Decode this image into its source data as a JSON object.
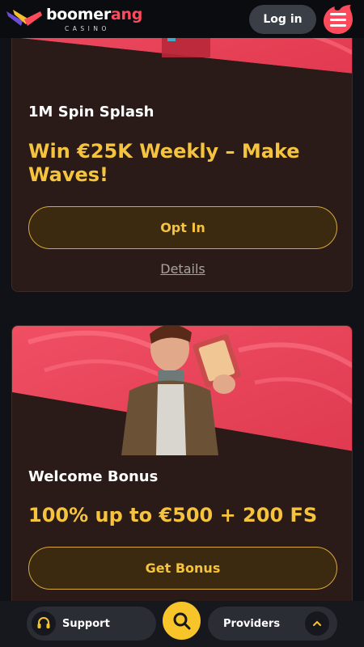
{
  "header": {
    "brand_name_part1": "boomer",
    "brand_name_part2": "ang",
    "brand_sub": "CASINO",
    "login_label": "Log in",
    "menu_icon": "hamburger-menu-icon"
  },
  "promotions": [
    {
      "title": "1M Spin Splash",
      "headline": "Win €25K Weekly – Make Waves!",
      "cta_label": "Opt In",
      "details_label": "Details"
    },
    {
      "title": "Welcome Bonus",
      "headline": "100% up to €500 + 200 FS",
      "cta_label": "Get Bonus"
    }
  ],
  "bottom_nav": {
    "support_label": "Support",
    "providers_label": "Providers",
    "search_icon": "search-icon",
    "support_icon": "headset-icon",
    "chevron_icon": "chevron-up-icon"
  },
  "colors": {
    "accent": "#f5c33d",
    "brand_red": "#ff4a5c",
    "card_bg": "#2a1b18",
    "page_bg": "#101218"
  }
}
